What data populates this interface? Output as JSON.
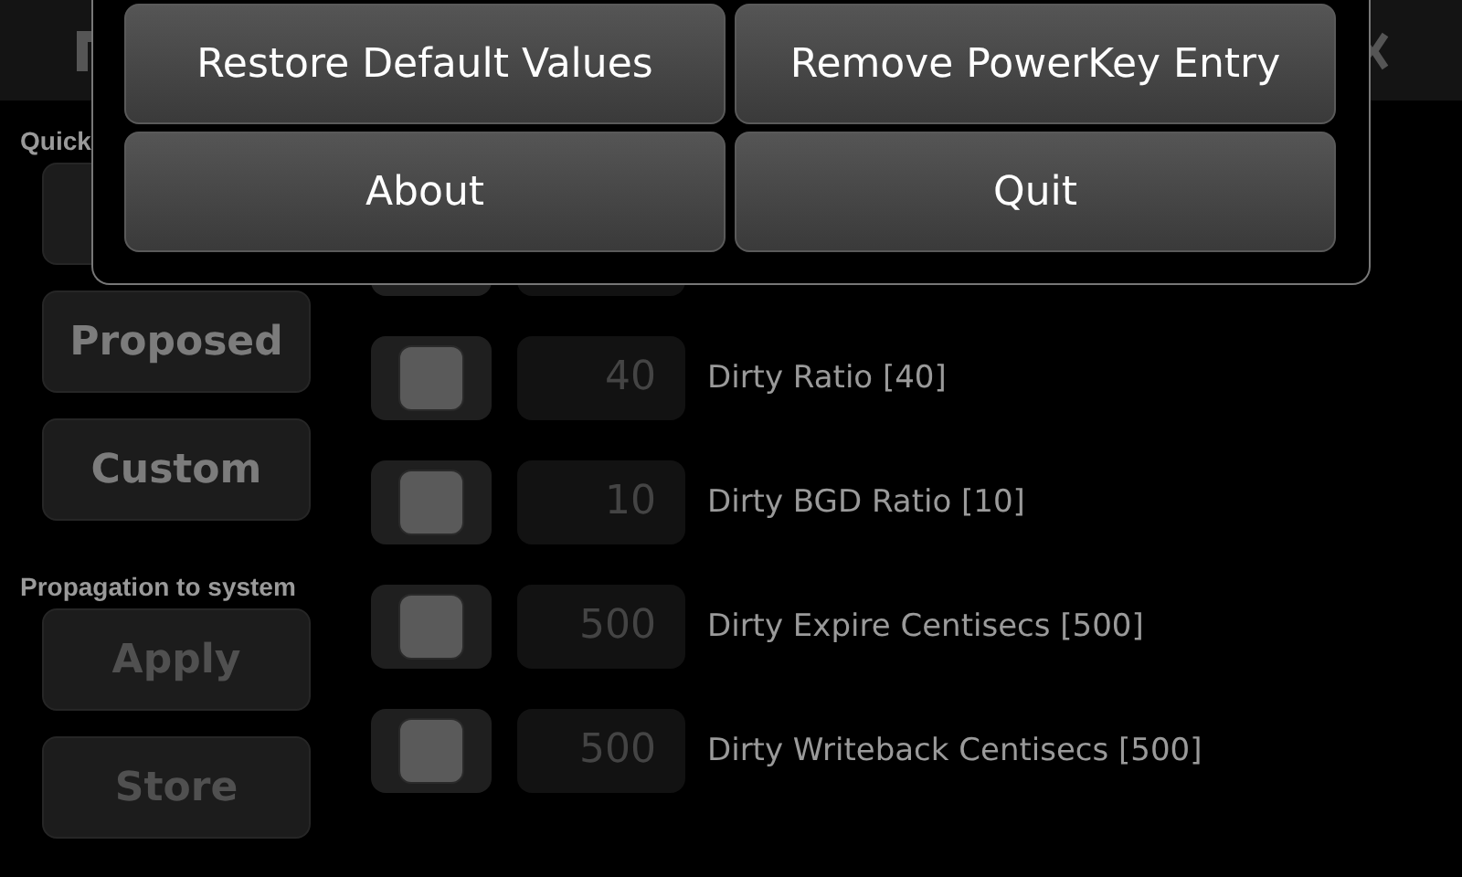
{
  "quick_section": {
    "label": "Quick",
    "buttons": [
      {
        "label": "Proposed",
        "disabled": false
      },
      {
        "label": "Custom",
        "disabled": false
      }
    ]
  },
  "propagation_section": {
    "label": "Propagation to system",
    "buttons": [
      {
        "label": "Apply",
        "disabled": true
      },
      {
        "label": "Store",
        "disabled": true
      }
    ]
  },
  "settings": [
    {
      "checked": false,
      "value": "40",
      "label": "Dirty Ratio [40]"
    },
    {
      "checked": false,
      "value": "10",
      "label": "Dirty BGD Ratio [10]"
    },
    {
      "checked": false,
      "value": "500",
      "label": "Dirty Expire Centisecs [500]"
    },
    {
      "checked": false,
      "value": "500",
      "label": "Dirty Writeback Centisecs [500]"
    }
  ],
  "menu": {
    "items": [
      "Restore Default Values",
      "Remove PowerKey Entry",
      "About",
      "Quit"
    ]
  }
}
